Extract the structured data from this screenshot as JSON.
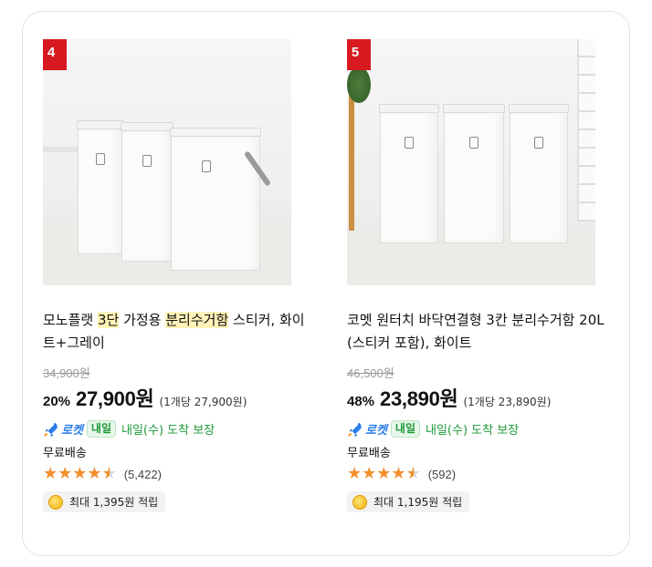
{
  "products": [
    {
      "rank": "4",
      "title_parts": [
        {
          "text": "모노플랫 ",
          "hl": false
        },
        {
          "text": "3단",
          "hl": true
        },
        {
          "text": " 가정용 ",
          "hl": false
        },
        {
          "text": "분리수거함",
          "hl": true
        },
        {
          "text": " 스티커, 화이트+그레이",
          "hl": false
        }
      ],
      "original_price": "34,900원",
      "discount": "20%",
      "price": "27,900원",
      "unit_price": "(1개당 27,900원)",
      "rocket_label": "로켓",
      "tomorrow_badge": "내일",
      "arrival": "내일(수) 도착 보장",
      "shipping": "무료배송",
      "rating": 4.5,
      "review_count": "(5,422)",
      "points": "최대 1,395원 적립"
    },
    {
      "rank": "5",
      "title_parts": [
        {
          "text": "코멧 원터치 바닥연결형 3칸 분리수거함 20L (스티커 포함), 화이트",
          "hl": false
        }
      ],
      "original_price": "46,500원",
      "discount": "48%",
      "price": "23,890원",
      "unit_price": "(1개당 23,890원)",
      "rocket_label": "로켓",
      "tomorrow_badge": "내일",
      "arrival": "내일(수) 도착 보장",
      "shipping": "무료배송",
      "rating": 4.5,
      "review_count": "(592)",
      "points": "최대 1,195원 적립"
    }
  ],
  "colors": {
    "rank_badge": "#d71920",
    "rocket": "#2b7de9",
    "arrival_green": "#1f9a3a",
    "star": "#f28f2d",
    "highlight": "#fff3b8"
  }
}
